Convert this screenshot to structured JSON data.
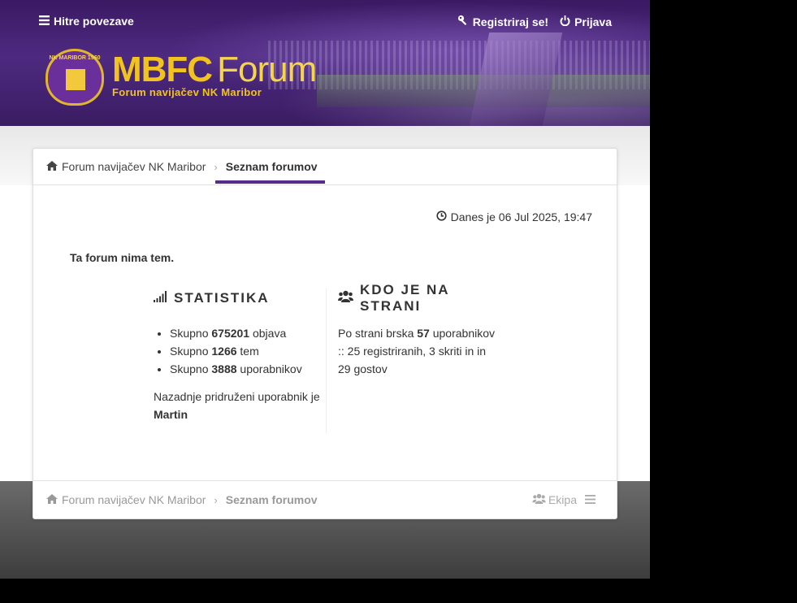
{
  "header": {
    "quick_links": "Hitre povezave",
    "register": "Registriraj se!",
    "login": "Prijava",
    "logo_badge": "NK MARIBOR 1960",
    "logo_mbfc": "MBFC",
    "logo_forum": "Forum",
    "logo_subtitle": "Forum navijačev NK Maribor"
  },
  "breadcrumb": {
    "home": "Forum navijačev NK Maribor",
    "current": "Seznam forumov"
  },
  "main": {
    "date": "Danes je 06 Jul 2025, 19:47",
    "no_topics": "Ta forum nima tem."
  },
  "statistics": {
    "title": "STATISTIKA",
    "posts_prefix": "Skupno",
    "posts_value": "675201",
    "posts_suffix": "objava",
    "topics_prefix": "Skupno",
    "topics_value": "1266",
    "topics_suffix": "tem",
    "users_prefix": "Skupno",
    "users_value": "3888",
    "users_suffix": "uporabnikov",
    "newest_prefix": "Nazadnje pridruženi uporabnik je",
    "newest_user": "Martin"
  },
  "who_online": {
    "title": "KDO JE NA STRANI",
    "prefix": "Po strani brska",
    "count": "57",
    "suffix": "uporabnikov :: 25 registriranih, 3 skriti in in 29 gostov"
  },
  "footer": {
    "home": "Forum navijačev NK Maribor",
    "current": "Seznam forumov",
    "team": "Ekipa"
  },
  "colors": {
    "accent": "#5a2b8a",
    "header": "#3b1a63",
    "logo_gold": "#f2c21f"
  }
}
